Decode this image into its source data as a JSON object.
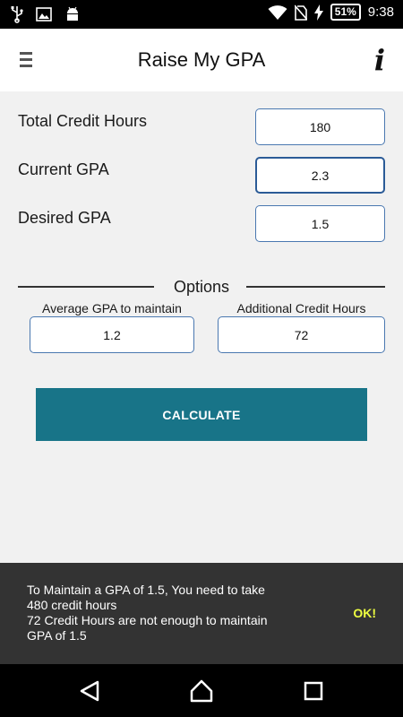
{
  "status_bar": {
    "battery": "51%",
    "time": "9:38"
  },
  "app_bar": {
    "title": "Raise My GPA",
    "info_glyph": "i"
  },
  "form": {
    "total_credit_hours": {
      "label": "Total Credit Hours",
      "value": "180"
    },
    "current_gpa": {
      "label": "Current GPA",
      "value": "2.3"
    },
    "desired_gpa": {
      "label": "Desired GPA",
      "value": "1.5"
    }
  },
  "options": {
    "title": "Options",
    "average_gpa": {
      "label": "Average GPA to maintain",
      "value": "1.2"
    },
    "additional_hours": {
      "label": "Additional Credit Hours",
      "value": "72"
    }
  },
  "calculate_label": "CALCULATE",
  "snackbar": {
    "message": "To Maintain a GPA of 1.5, You need to take\n480 credit hours\n72 Credit Hours are not enough to maintain\nGPA of 1.5",
    "action": "OK!"
  },
  "colors": {
    "accent": "#187488",
    "field_border": "#4a78b0",
    "snackbar_bg": "#333333",
    "snackbar_action": "#eeff41"
  },
  "icons": [
    "usb-icon",
    "image-icon",
    "android-icon",
    "wifi-icon",
    "no-sim-icon",
    "battery-icon",
    "menu-icon",
    "info-icon",
    "back-icon",
    "home-icon",
    "recents-icon"
  ]
}
